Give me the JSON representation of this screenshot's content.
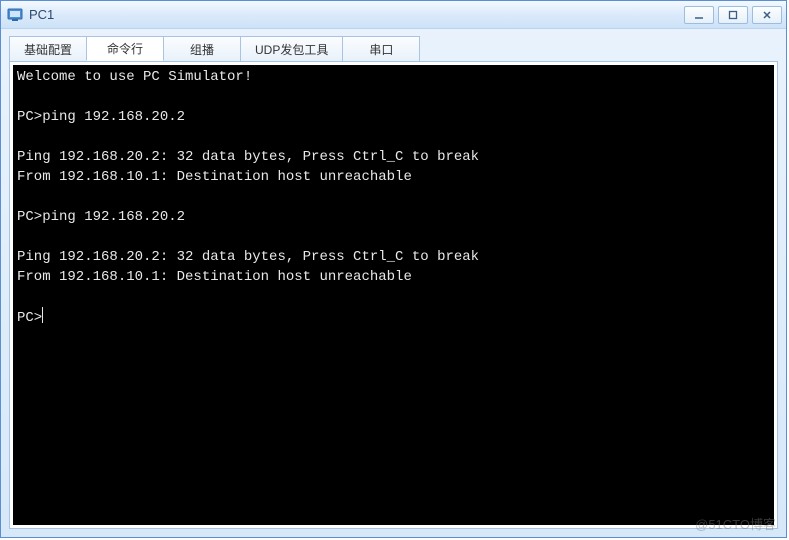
{
  "window": {
    "title": "PC1"
  },
  "tabs": [
    {
      "label": "基础配置"
    },
    {
      "label": "命令行"
    },
    {
      "label": "组播"
    },
    {
      "label": "UDP发包工具"
    },
    {
      "label": "串口"
    }
  ],
  "active_tab_index": 1,
  "terminal": {
    "lines": [
      "Welcome to use PC Simulator!",
      "",
      "PC>ping 192.168.20.2",
      "",
      "Ping 192.168.20.2: 32 data bytes, Press Ctrl_C to break",
      "From 192.168.10.1: Destination host unreachable",
      "",
      "PC>ping 192.168.20.2",
      "",
      "Ping 192.168.20.2: 32 data bytes, Press Ctrl_C to break",
      "From 192.168.10.1: Destination host unreachable",
      ""
    ],
    "prompt": "PC>"
  },
  "watermark": "@51CTO博客"
}
